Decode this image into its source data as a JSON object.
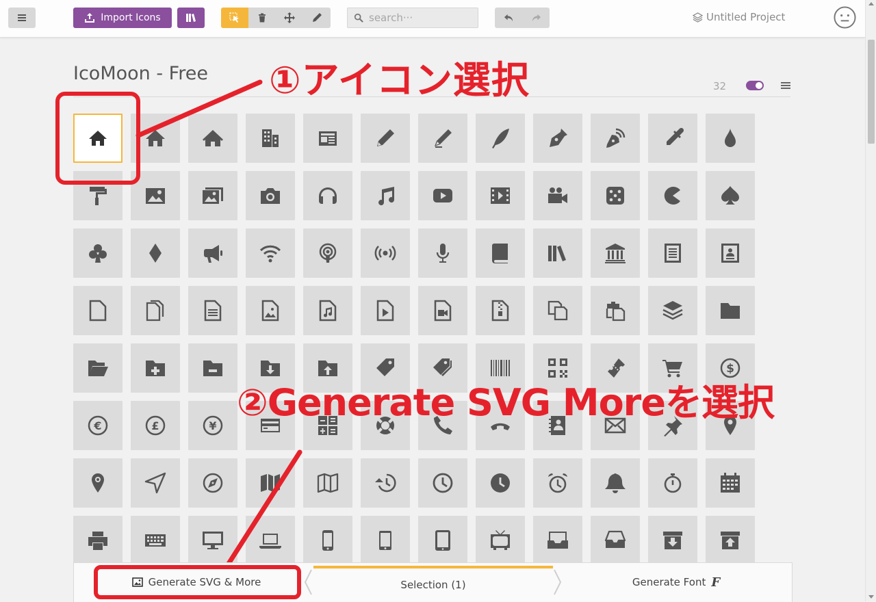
{
  "toolbar": {
    "menu_icon": "hamburger-icon",
    "import_label": "Import Icons",
    "search_placeholder": "search···",
    "project_name": "Untitled Project",
    "accent_color": "#8a4f9d",
    "active_tool_color": "#f5b73b"
  },
  "icon_set": {
    "title": "IcoMoon - Free",
    "count": "32"
  },
  "grid": {
    "selected_icon": "home",
    "rows": [
      [
        "home",
        "home2",
        "home3",
        "office",
        "newspaper",
        "pencil",
        "pencil2",
        "quill",
        "pen",
        "blog",
        "eyedropper",
        "droplet"
      ],
      [
        "paint-format",
        "image",
        "images",
        "camera",
        "headphones",
        "music",
        "play",
        "film",
        "video-camera",
        "dice",
        "pacman",
        "spades"
      ],
      [
        "clubs",
        "diamonds",
        "bullhorn",
        "connection",
        "podcast",
        "feed",
        "mic",
        "book",
        "books",
        "library",
        "file-text",
        "profile"
      ],
      [
        "file-empty",
        "files-empty",
        "file-text2",
        "file-picture",
        "file-music",
        "file-play",
        "file-video",
        "file-zip",
        "copy",
        "paste",
        "stack",
        "folder"
      ],
      [
        "folder-open",
        "folder-plus",
        "folder-minus",
        "folder-download",
        "folder-upload",
        "price-tag",
        "price-tags",
        "barcode",
        "qrcode",
        "ticket",
        "cart",
        "coin-dollar"
      ],
      [
        "coin-euro",
        "coin-pound",
        "coin-yen",
        "credit-card",
        "calculator",
        "lifebuoy",
        "phone",
        "phone-hang-up",
        "address-book",
        "envelop",
        "pushpin",
        "location"
      ],
      [
        "location2",
        "compass",
        "compass2",
        "map",
        "map2",
        "history",
        "clock",
        "clock2",
        "alarm",
        "bell",
        "stopwatch",
        "calendar"
      ],
      [
        "printer",
        "keyboard",
        "display",
        "laptop",
        "mobile",
        "mobile2",
        "tablet",
        "tv",
        "drawer",
        "drawer2",
        "box-add",
        "box-remove"
      ]
    ]
  },
  "annotations": {
    "step1": "①アイコン選択",
    "step2": "②Generate SVG Moreを選択",
    "color": "#e5222b"
  },
  "bottom_tabs": {
    "generate_svg": "Generate SVG & More",
    "selection": "Selection (1)",
    "generate_font": "Generate Font",
    "font_glyph": "F"
  }
}
